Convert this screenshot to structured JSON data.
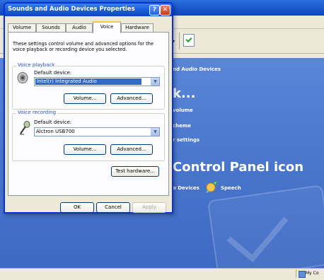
{
  "background": {
    "header_text": "nd Audio Devices",
    "heading_1": "k...",
    "link_volume": "volume",
    "link_scheme": "cheme",
    "link_settings": "r settings",
    "heading_2": "Control Panel icon",
    "link_devices": "o Devices",
    "link_speech": "Speech",
    "toolbar_dropdown": "▾",
    "status_text": "My Co"
  },
  "dialog": {
    "title": "Sounds and Audio Devices Properties",
    "help_label": "?",
    "close_label": "✕",
    "tabs": [
      {
        "label": "Volume"
      },
      {
        "label": "Sounds"
      },
      {
        "label": "Audio"
      },
      {
        "label": "Voice"
      },
      {
        "label": "Hardware"
      }
    ],
    "active_tab": "Voice",
    "description": "These settings control volume and advanced options for the voice playback or recording device you selected.",
    "voice_playback": {
      "group_label": "Voice playback",
      "default_device_label": "Default device:",
      "device_value": "Intel(r) Integrated Audio",
      "volume_button": "Volume...",
      "advanced_button": "Advanced..."
    },
    "voice_recording": {
      "group_label": "Voice recording",
      "default_device_label": "Default device:",
      "device_value": "Alctron USB700",
      "volume_button": "Volume...",
      "advanced_button": "Advanced..."
    },
    "test_hardware_button": "Test hardware...",
    "ok_button": "OK",
    "cancel_button": "Cancel",
    "apply_button": "Apply"
  },
  "colors": {
    "dialog_border": "#0831d9",
    "title_bar": "#1e5fdc",
    "content_blue": "#4c79cf",
    "selection": "#316ac5",
    "group_label": "#2155c7"
  },
  "icons": [
    "help-icon",
    "close-icon",
    "speaker-icon",
    "microphone-icon",
    "dropdown-arrow-icon",
    "speech-icon",
    "my-computer-icon"
  ]
}
